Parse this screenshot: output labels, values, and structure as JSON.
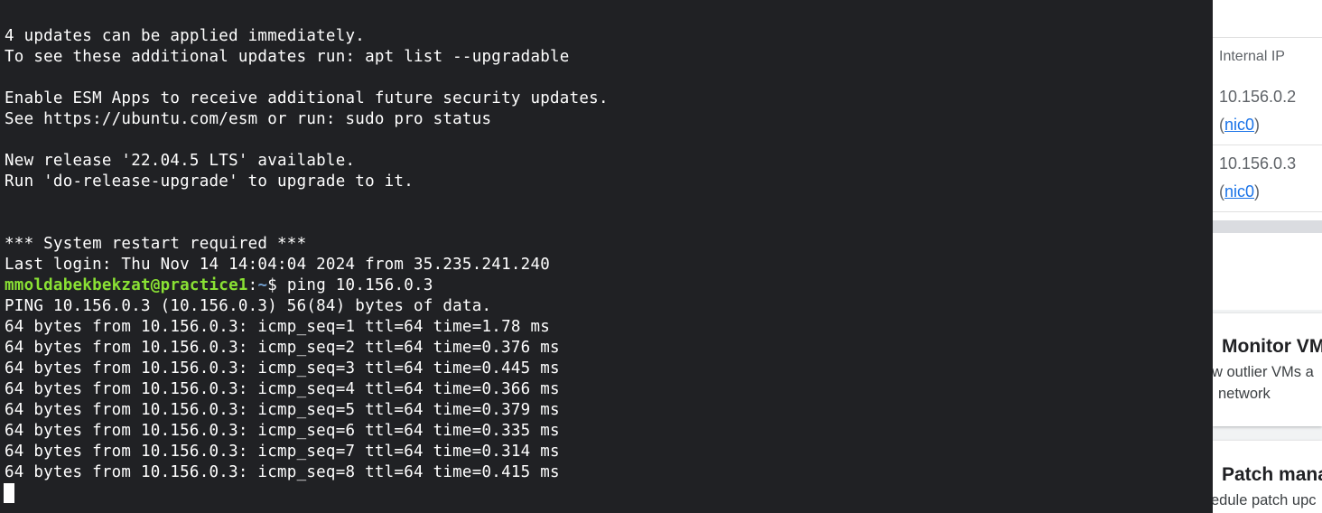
{
  "terminal": {
    "lines": [
      "4 updates can be applied immediately.",
      "To see these additional updates run: apt list --upgradable",
      "",
      "Enable ESM Apps to receive additional future security updates.",
      "See https://ubuntu.com/esm or run: sudo pro status",
      "",
      "New release '22.04.5 LTS' available.",
      "Run 'do-release-upgrade' to upgrade to it.",
      "",
      "",
      "*** System restart required ***",
      "Last login: Thu Nov 14 14:04:04 2024 from 35.235.241.240"
    ],
    "prompt": {
      "user_host": "mmoldabekbekzat@practice1",
      "separator": ":",
      "path": "~",
      "symbol": "$",
      "command": " ping 10.156.0.3"
    },
    "output": [
      "PING 10.156.0.3 (10.156.0.3) 56(84) bytes of data.",
      "64 bytes from 10.156.0.3: icmp_seq=1 ttl=64 time=1.78 ms",
      "64 bytes from 10.156.0.3: icmp_seq=2 ttl=64 time=0.376 ms",
      "64 bytes from 10.156.0.3: icmp_seq=3 ttl=64 time=0.445 ms",
      "64 bytes from 10.156.0.3: icmp_seq=4 ttl=64 time=0.366 ms",
      "64 bytes from 10.156.0.3: icmp_seq=5 ttl=64 time=0.379 ms",
      "64 bytes from 10.156.0.3: icmp_seq=6 ttl=64 time=0.335 ms",
      "64 bytes from 10.156.0.3: icmp_seq=7 ttl=64 time=0.314 ms",
      "64 bytes from 10.156.0.3: icmp_seq=8 ttl=64 time=0.415 ms"
    ]
  },
  "side_panel": {
    "table": {
      "header": "Internal IP",
      "rows": [
        {
          "ip": "10.156.0.2",
          "open": "(",
          "nic": "nic0",
          "close": ")"
        },
        {
          "ip": "10.156.0.3",
          "open": "(",
          "nic": "nic0",
          "close": ")"
        }
      ]
    },
    "cards": [
      {
        "title": "Monitor VMs",
        "desc_line1": "w outlier VMs a",
        "desc_line2": "network"
      },
      {
        "title": "Patch mana",
        "desc_line1": "edule patch upc"
      }
    ]
  },
  "colors": {
    "terminal_bg": "#202124",
    "prompt_user": "#8ae234",
    "prompt_path": "#729fcf",
    "link": "#1a73e8"
  }
}
